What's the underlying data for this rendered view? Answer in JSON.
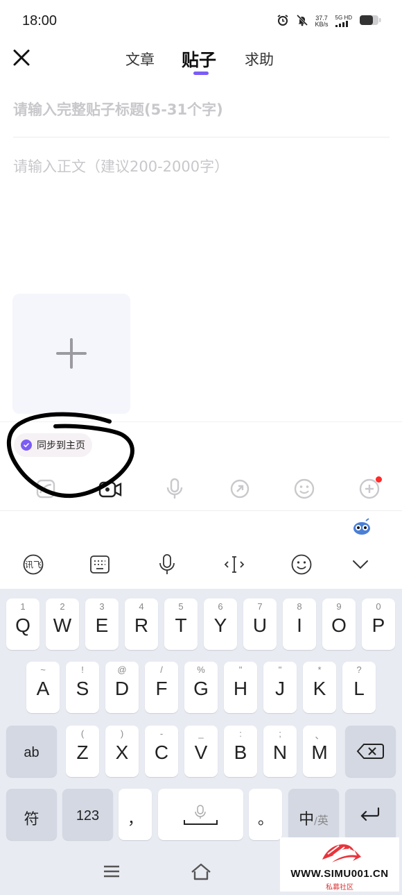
{
  "status_bar": {
    "time": "18:00",
    "speed_value": "37.7",
    "speed_unit": "KB/s",
    "network_a": "5G",
    "network_b": "HD",
    "icons": [
      "alarm-icon",
      "mute-bell-icon",
      "signal-icon",
      "battery-icon"
    ]
  },
  "header": {
    "tabs": [
      {
        "label": "文章",
        "active": false
      },
      {
        "label": "贴子",
        "active": true
      },
      {
        "label": "求助",
        "active": false
      }
    ]
  },
  "editor": {
    "title_placeholder": "请输入完整贴子标题(5-31个字)",
    "body_placeholder": "请输入正文（建议200-2000字）"
  },
  "sync": {
    "label": "同步到主页",
    "checked": true
  },
  "toolbar": {
    "icons": [
      "image-icon",
      "video-icon",
      "microphone-icon",
      "link-icon",
      "emoji-icon",
      "add-circle-icon"
    ]
  },
  "ime_toolbar": {
    "icons": [
      "ifly-logo-icon",
      "keyboard-icon",
      "voice-icon",
      "cursor-move-icon",
      "emoji-icon",
      "collapse-icon"
    ]
  },
  "keyboard": {
    "row1": [
      {
        "hint": "1",
        "key": "Q"
      },
      {
        "hint": "2",
        "key": "W"
      },
      {
        "hint": "3",
        "key": "E"
      },
      {
        "hint": "4",
        "key": "R"
      },
      {
        "hint": "5",
        "key": "T"
      },
      {
        "hint": "6",
        "key": "Y"
      },
      {
        "hint": "7",
        "key": "U"
      },
      {
        "hint": "8",
        "key": "I"
      },
      {
        "hint": "9",
        "key": "O"
      },
      {
        "hint": "0",
        "key": "P"
      }
    ],
    "row2": [
      {
        "hint": "~",
        "key": "A"
      },
      {
        "hint": "!",
        "key": "S"
      },
      {
        "hint": "@",
        "key": "D"
      },
      {
        "hint": "/",
        "key": "F"
      },
      {
        "hint": "%",
        "key": "G"
      },
      {
        "hint": "\"",
        "key": "H"
      },
      {
        "hint": "\"",
        "key": "J"
      },
      {
        "hint": "*",
        "key": "K"
      },
      {
        "hint": "?",
        "key": "L"
      }
    ],
    "row3": [
      {
        "hint": "(",
        "key": "Z"
      },
      {
        "hint": ")",
        "key": "X"
      },
      {
        "hint": "-",
        "key": "C"
      },
      {
        "hint": "_",
        "key": "V"
      },
      {
        "hint": ":",
        "key": "B"
      },
      {
        "hint": ";",
        "key": "N"
      },
      {
        "hint": "、",
        "key": "M"
      }
    ],
    "shift_label": "ab",
    "symbols_label": "符",
    "numbers_label": "123",
    "comma_label": "，",
    "period_label": "。",
    "lang_zh": "中",
    "lang_sep": "/",
    "lang_en": "英"
  },
  "watermark": {
    "text": "WWW.SIMU001.CN",
    "sub": "私募社区"
  }
}
